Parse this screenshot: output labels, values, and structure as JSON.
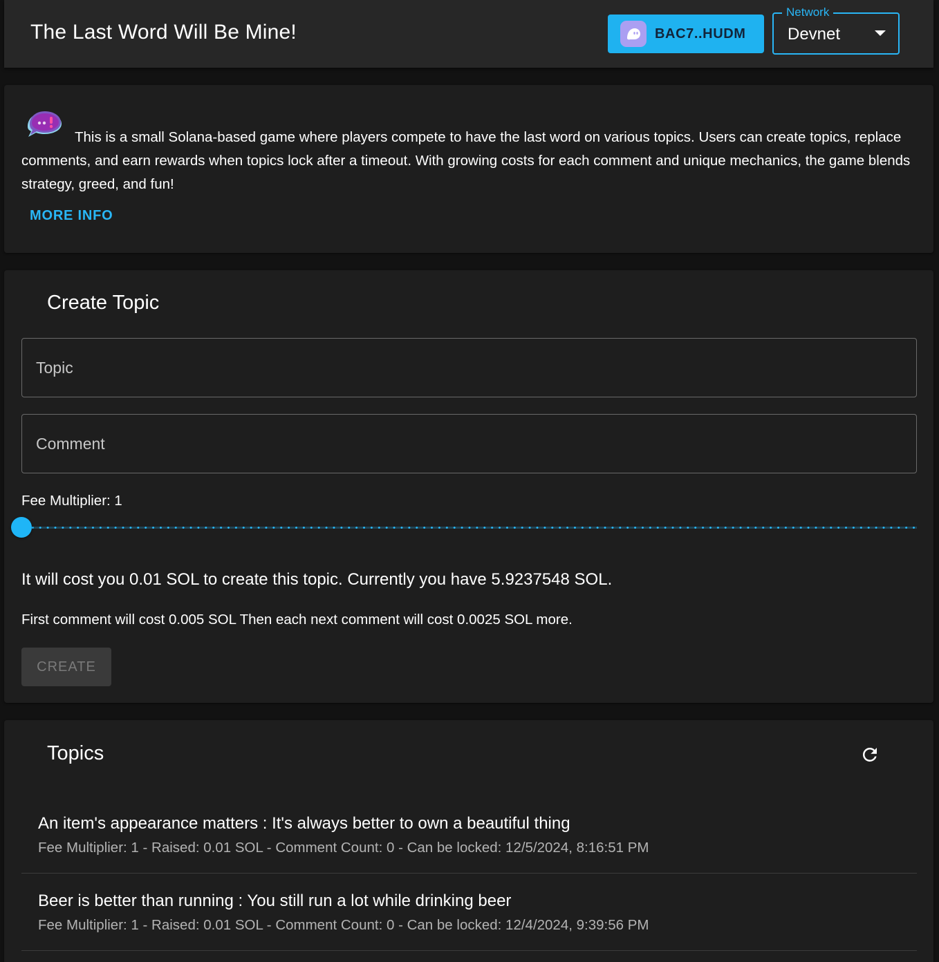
{
  "header": {
    "title": "The Last Word Will Be Mine!",
    "wallet": {
      "label": "BAC7..HUDM",
      "icon": "phantom-ghost-icon",
      "color": "#1fb2f0"
    },
    "network": {
      "legend": "Network",
      "value": "Devnet"
    }
  },
  "intro": {
    "icon": "speech-bubble-exclamation-icon",
    "text": "This is a small Solana-based game where players compete to have the last word on various topics. Users can create topics, replace comments, and earn rewards when topics lock after a timeout. With growing costs for each comment and unique mechanics, the game blends strategy, greed, and fun!",
    "more_info_label": "MORE INFO"
  },
  "create": {
    "title": "Create Topic",
    "topic_placeholder": "Topic",
    "comment_placeholder": "Comment",
    "fee_label": "Fee Multiplier: 1",
    "slider": {
      "value": 1,
      "min": 1,
      "max": 100
    },
    "cost_text": "It will cost you 0.01 SOL to create this topic. Currently you have 5.9237548 SOL.",
    "comment_cost_text": "First comment will cost 0.005 SOL Then each next comment will cost 0.0025 SOL more.",
    "create_label": "CREATE"
  },
  "topics": {
    "title": "Topics",
    "refresh_icon": "refresh-icon",
    "items": [
      {
        "primary": "An item's appearance matters : It's always better to own a beautiful thing",
        "secondary": "Fee Multiplier: 1 - Raised: 0.01 SOL - Comment Count: 0 - Can be locked: 12/5/2024, 8:16:51 PM"
      },
      {
        "primary": "Beer is better than running : You still run a lot while drinking beer",
        "secondary": "Fee Multiplier: 1 - Raised: 0.01 SOL - Comment Count: 0 - Can be locked: 12/4/2024, 9:39:56 PM"
      }
    ]
  },
  "colors": {
    "accent": "#29b6f6",
    "background": "#121212",
    "surface": "#1e1e1e"
  }
}
